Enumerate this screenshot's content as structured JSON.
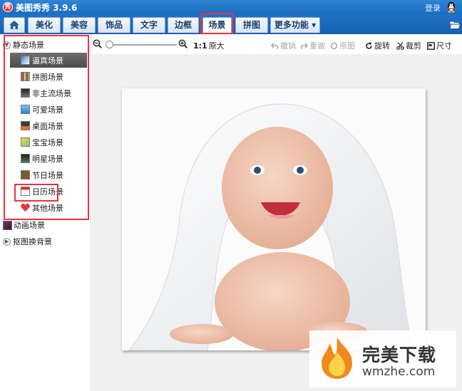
{
  "window": {
    "title": "美图秀秀 3.9.6",
    "login_label": "登录"
  },
  "menu": {
    "tabs": [
      {
        "label": "美化"
      },
      {
        "label": "美容"
      },
      {
        "label": "饰品"
      },
      {
        "label": "文字"
      },
      {
        "label": "边框"
      },
      {
        "label": "场景"
      },
      {
        "label": "拼图"
      },
      {
        "label": "更多功能 ▾"
      }
    ],
    "active_tab": "场景"
  },
  "sidebar": {
    "static_group": "静态场景",
    "items": [
      {
        "label": "逼真场景"
      },
      {
        "label": "拼图场景"
      },
      {
        "label": "非主流场景"
      },
      {
        "label": "可爱场景"
      },
      {
        "label": "桌面场景"
      },
      {
        "label": "宝宝场景"
      },
      {
        "label": "明星场景"
      },
      {
        "label": "节日场景"
      },
      {
        "label": "日历场景"
      },
      {
        "label": "其他场景"
      }
    ],
    "animated_group": "动画场景",
    "cutout_group": "抠图换背景"
  },
  "toolbar": {
    "ratio_label": "1:1",
    "original_size_label": "原大",
    "zoom_level": 0,
    "undo_label": "撤销",
    "redo_label": "重做",
    "original_label": "原图",
    "rotate_label": "旋转",
    "crop_label": "裁剪",
    "size_label": "尺寸"
  },
  "watermark": {
    "brand": "完美下载",
    "domain": "wmzhe.com"
  },
  "colors": {
    "title_blue": "#1c6cc0",
    "highlight_red": "#e8343a",
    "flame_orange": "#f08a1c"
  }
}
